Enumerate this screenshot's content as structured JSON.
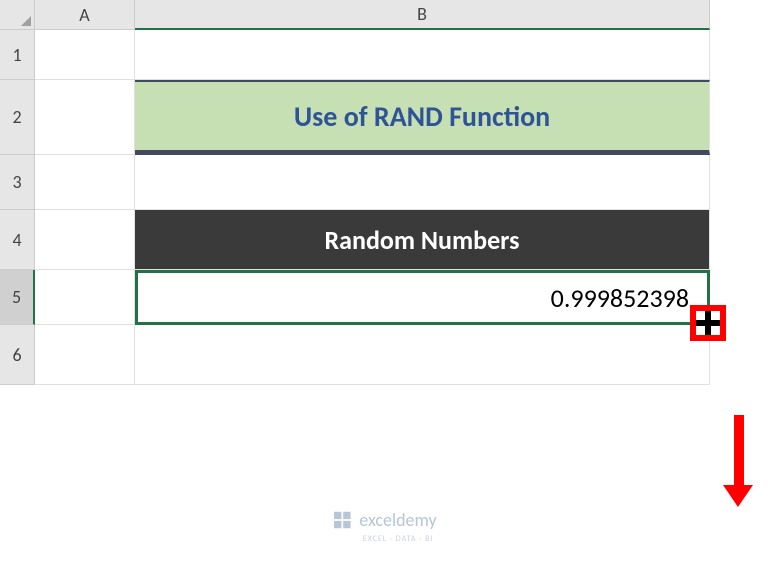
{
  "columns": {
    "a": "A",
    "b": "B"
  },
  "rows": {
    "r1": "1",
    "r2": "2",
    "r3": "3",
    "r4": "4",
    "r5": "5",
    "r6": "6"
  },
  "cells": {
    "b2_title": "Use of RAND Function",
    "b4_header": "Random Numbers",
    "b5_value": "0.999852398"
  },
  "watermark": {
    "brand": "exceldemy",
    "tagline": "EXCEL · DATA · BI"
  }
}
